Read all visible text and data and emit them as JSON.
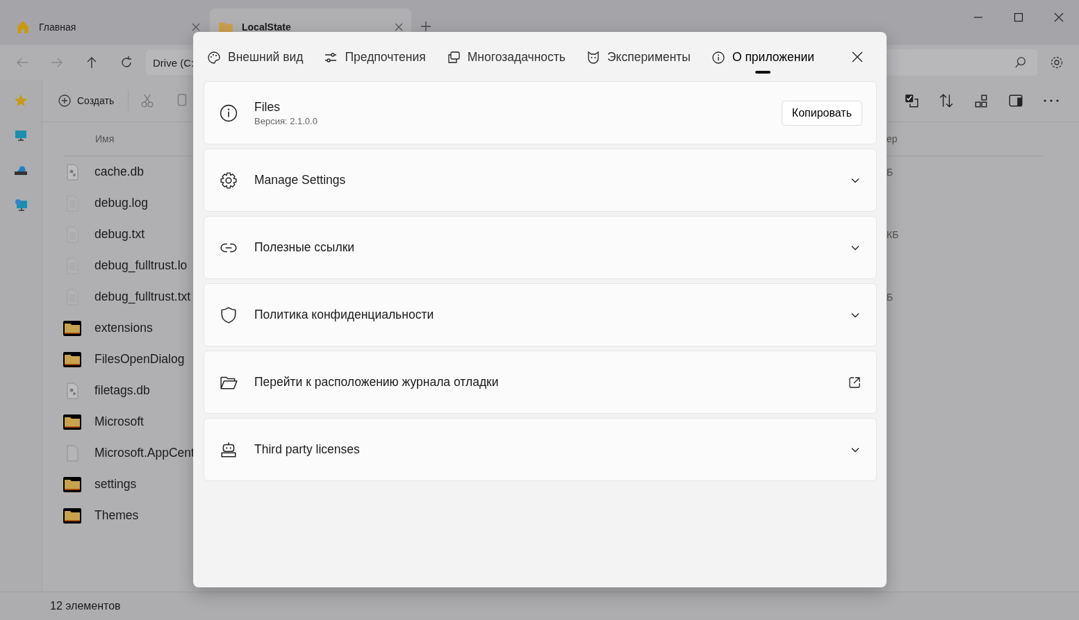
{
  "browser_tabs": [
    {
      "label": "Главная",
      "selected": false
    },
    {
      "label": "LocalState",
      "selected": true
    }
  ],
  "address": {
    "value": "Drive (C:"
  },
  "toolbar": {
    "create_label": "Создать"
  },
  "file_list": {
    "column_name": "Имя",
    "column_size_fragment": "ер",
    "rows": [
      {
        "name": "cache.db",
        "kind": "db",
        "size_fragment": "Б"
      },
      {
        "name": "debug.log",
        "kind": "text"
      },
      {
        "name": "debug.txt",
        "kind": "text",
        "size_fragment": "КБ"
      },
      {
        "name": "debug_fulltrust.lo",
        "kind": "text"
      },
      {
        "name": "debug_fulltrust.txt",
        "kind": "text",
        "size_fragment": "Б"
      },
      {
        "name": "extensions",
        "kind": "folder"
      },
      {
        "name": "FilesOpenDialog",
        "kind": "folder"
      },
      {
        "name": "filetags.db",
        "kind": "db"
      },
      {
        "name": "Microsoft",
        "kind": "folder"
      },
      {
        "name": "Microsoft.AppCent",
        "kind": "file"
      },
      {
        "name": "settings",
        "kind": "folder"
      },
      {
        "name": "Themes",
        "kind": "folder"
      }
    ]
  },
  "status_bar": {
    "count": "12 элементов"
  },
  "settings_dialog": {
    "tabs": [
      {
        "label": "Внешний вид",
        "selected": false
      },
      {
        "label": "Предпочтения",
        "selected": false
      },
      {
        "label": "Многозадачность",
        "selected": false
      },
      {
        "label": "Эксперименты",
        "selected": false
      },
      {
        "label": "О приложении",
        "selected": true
      }
    ],
    "cards": [
      {
        "kind": "info",
        "title": "Files",
        "subtitle": "Версия: 2.1.0.0",
        "button": "Копировать"
      },
      {
        "kind": "expander",
        "title": "Manage Settings"
      },
      {
        "kind": "expander",
        "title": "Полезные ссылки"
      },
      {
        "kind": "expander",
        "title": "Политика конфиденциальности"
      },
      {
        "kind": "external",
        "title": "Перейти к расположению журнала отладки"
      },
      {
        "kind": "expander",
        "title": "Third party licenses"
      }
    ]
  }
}
